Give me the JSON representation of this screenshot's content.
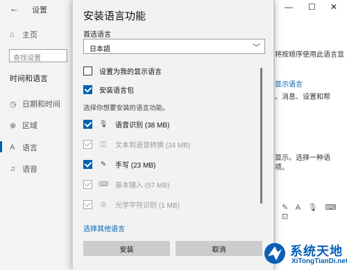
{
  "window": {
    "title": "设置",
    "controls": [
      "—",
      "☐",
      "✕"
    ]
  },
  "sidebar": {
    "home_label": "主页",
    "search_placeholder": "查找设置",
    "section_heading": "时间和语言",
    "items": [
      {
        "label": "日期和时间",
        "icon": "calendar-clock-icon"
      },
      {
        "label": "区域",
        "icon": "globe-icon"
      },
      {
        "label": "语言",
        "icon": "language-icon"
      },
      {
        "label": "语音",
        "icon": "microphone-icon"
      }
    ]
  },
  "background_right": {
    "frag1": "将按顺序使用此语言显",
    "frag2": "显示语言",
    "frag3": "、消息、设置和帮",
    "frag4": "显示。选择一种语",
    "frag5": "项。"
  },
  "dialog": {
    "title": "安装语言功能",
    "preferred_label": "首选语言",
    "dropdown_value": "日本語",
    "options": [
      {
        "label": "设置为我的显示语言",
        "checked": false
      },
      {
        "label": "安装语言包",
        "checked": true
      }
    ],
    "features_heading": "选择你想要安装的语言功能。",
    "features": [
      {
        "label": "语音识别 (38 MB)",
        "icon": "microphone-icon",
        "checked": true,
        "disabled": false
      },
      {
        "label": "文本到语音转换 (34 MB)",
        "icon": "speech-bubble-icon",
        "checked": true,
        "disabled": true
      },
      {
        "label": "手写 (23 MB)",
        "icon": "pen-icon",
        "checked": true,
        "disabled": false
      },
      {
        "label": "基本键入 (57 MB)",
        "icon": "keyboard-icon",
        "checked": true,
        "disabled": true
      },
      {
        "label": "光学字符识别 (1 MB)",
        "icon": "camera-icon",
        "checked": true,
        "disabled": true
      }
    ],
    "more_link": "选择其他语言",
    "install_button": "安装",
    "cancel_button": "取消"
  },
  "watermark": {
    "text": "系统天地",
    "sub": "XiTongTianDi.net"
  },
  "colors": {
    "accent": "#0063b1",
    "dialog_bg": "#f2f2f2",
    "button_bg": "#cccccc"
  }
}
